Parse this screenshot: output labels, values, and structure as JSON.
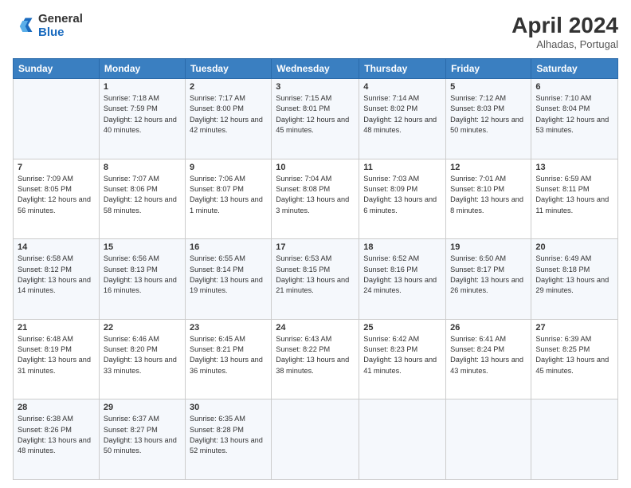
{
  "header": {
    "logo_general": "General",
    "logo_blue": "Blue",
    "month_title": "April 2024",
    "location": "Alhadas, Portugal"
  },
  "days_of_week": [
    "Sunday",
    "Monday",
    "Tuesday",
    "Wednesday",
    "Thursday",
    "Friday",
    "Saturday"
  ],
  "weeks": [
    [
      {
        "day": "",
        "sunrise": "",
        "sunset": "",
        "daylight": ""
      },
      {
        "day": "1",
        "sunrise": "Sunrise: 7:18 AM",
        "sunset": "Sunset: 7:59 PM",
        "daylight": "Daylight: 12 hours and 40 minutes."
      },
      {
        "day": "2",
        "sunrise": "Sunrise: 7:17 AM",
        "sunset": "Sunset: 8:00 PM",
        "daylight": "Daylight: 12 hours and 42 minutes."
      },
      {
        "day": "3",
        "sunrise": "Sunrise: 7:15 AM",
        "sunset": "Sunset: 8:01 PM",
        "daylight": "Daylight: 12 hours and 45 minutes."
      },
      {
        "day": "4",
        "sunrise": "Sunrise: 7:14 AM",
        "sunset": "Sunset: 8:02 PM",
        "daylight": "Daylight: 12 hours and 48 minutes."
      },
      {
        "day": "5",
        "sunrise": "Sunrise: 7:12 AM",
        "sunset": "Sunset: 8:03 PM",
        "daylight": "Daylight: 12 hours and 50 minutes."
      },
      {
        "day": "6",
        "sunrise": "Sunrise: 7:10 AM",
        "sunset": "Sunset: 8:04 PM",
        "daylight": "Daylight: 12 hours and 53 minutes."
      }
    ],
    [
      {
        "day": "7",
        "sunrise": "Sunrise: 7:09 AM",
        "sunset": "Sunset: 8:05 PM",
        "daylight": "Daylight: 12 hours and 56 minutes."
      },
      {
        "day": "8",
        "sunrise": "Sunrise: 7:07 AM",
        "sunset": "Sunset: 8:06 PM",
        "daylight": "Daylight: 12 hours and 58 minutes."
      },
      {
        "day": "9",
        "sunrise": "Sunrise: 7:06 AM",
        "sunset": "Sunset: 8:07 PM",
        "daylight": "Daylight: 13 hours and 1 minute."
      },
      {
        "day": "10",
        "sunrise": "Sunrise: 7:04 AM",
        "sunset": "Sunset: 8:08 PM",
        "daylight": "Daylight: 13 hours and 3 minutes."
      },
      {
        "day": "11",
        "sunrise": "Sunrise: 7:03 AM",
        "sunset": "Sunset: 8:09 PM",
        "daylight": "Daylight: 13 hours and 6 minutes."
      },
      {
        "day": "12",
        "sunrise": "Sunrise: 7:01 AM",
        "sunset": "Sunset: 8:10 PM",
        "daylight": "Daylight: 13 hours and 8 minutes."
      },
      {
        "day": "13",
        "sunrise": "Sunrise: 6:59 AM",
        "sunset": "Sunset: 8:11 PM",
        "daylight": "Daylight: 13 hours and 11 minutes."
      }
    ],
    [
      {
        "day": "14",
        "sunrise": "Sunrise: 6:58 AM",
        "sunset": "Sunset: 8:12 PM",
        "daylight": "Daylight: 13 hours and 14 minutes."
      },
      {
        "day": "15",
        "sunrise": "Sunrise: 6:56 AM",
        "sunset": "Sunset: 8:13 PM",
        "daylight": "Daylight: 13 hours and 16 minutes."
      },
      {
        "day": "16",
        "sunrise": "Sunrise: 6:55 AM",
        "sunset": "Sunset: 8:14 PM",
        "daylight": "Daylight: 13 hours and 19 minutes."
      },
      {
        "day": "17",
        "sunrise": "Sunrise: 6:53 AM",
        "sunset": "Sunset: 8:15 PM",
        "daylight": "Daylight: 13 hours and 21 minutes."
      },
      {
        "day": "18",
        "sunrise": "Sunrise: 6:52 AM",
        "sunset": "Sunset: 8:16 PM",
        "daylight": "Daylight: 13 hours and 24 minutes."
      },
      {
        "day": "19",
        "sunrise": "Sunrise: 6:50 AM",
        "sunset": "Sunset: 8:17 PM",
        "daylight": "Daylight: 13 hours and 26 minutes."
      },
      {
        "day": "20",
        "sunrise": "Sunrise: 6:49 AM",
        "sunset": "Sunset: 8:18 PM",
        "daylight": "Daylight: 13 hours and 29 minutes."
      }
    ],
    [
      {
        "day": "21",
        "sunrise": "Sunrise: 6:48 AM",
        "sunset": "Sunset: 8:19 PM",
        "daylight": "Daylight: 13 hours and 31 minutes."
      },
      {
        "day": "22",
        "sunrise": "Sunrise: 6:46 AM",
        "sunset": "Sunset: 8:20 PM",
        "daylight": "Daylight: 13 hours and 33 minutes."
      },
      {
        "day": "23",
        "sunrise": "Sunrise: 6:45 AM",
        "sunset": "Sunset: 8:21 PM",
        "daylight": "Daylight: 13 hours and 36 minutes."
      },
      {
        "day": "24",
        "sunrise": "Sunrise: 6:43 AM",
        "sunset": "Sunset: 8:22 PM",
        "daylight": "Daylight: 13 hours and 38 minutes."
      },
      {
        "day": "25",
        "sunrise": "Sunrise: 6:42 AM",
        "sunset": "Sunset: 8:23 PM",
        "daylight": "Daylight: 13 hours and 41 minutes."
      },
      {
        "day": "26",
        "sunrise": "Sunrise: 6:41 AM",
        "sunset": "Sunset: 8:24 PM",
        "daylight": "Daylight: 13 hours and 43 minutes."
      },
      {
        "day": "27",
        "sunrise": "Sunrise: 6:39 AM",
        "sunset": "Sunset: 8:25 PM",
        "daylight": "Daylight: 13 hours and 45 minutes."
      }
    ],
    [
      {
        "day": "28",
        "sunrise": "Sunrise: 6:38 AM",
        "sunset": "Sunset: 8:26 PM",
        "daylight": "Daylight: 13 hours and 48 minutes."
      },
      {
        "day": "29",
        "sunrise": "Sunrise: 6:37 AM",
        "sunset": "Sunset: 8:27 PM",
        "daylight": "Daylight: 13 hours and 50 minutes."
      },
      {
        "day": "30",
        "sunrise": "Sunrise: 6:35 AM",
        "sunset": "Sunset: 8:28 PM",
        "daylight": "Daylight: 13 hours and 52 minutes."
      },
      {
        "day": "",
        "sunrise": "",
        "sunset": "",
        "daylight": ""
      },
      {
        "day": "",
        "sunrise": "",
        "sunset": "",
        "daylight": ""
      },
      {
        "day": "",
        "sunrise": "",
        "sunset": "",
        "daylight": ""
      },
      {
        "day": "",
        "sunrise": "",
        "sunset": "",
        "daylight": ""
      }
    ]
  ]
}
